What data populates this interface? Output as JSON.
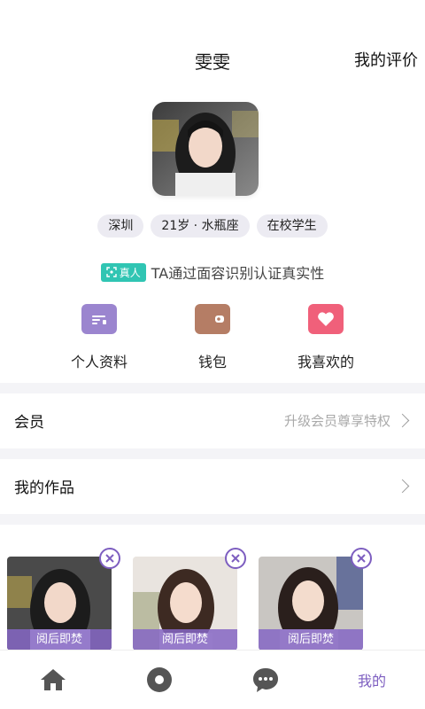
{
  "header": {
    "title": "雯雯",
    "right_link": "我的评价"
  },
  "profile": {
    "tags": [
      "深圳",
      "21岁 · 水瓶座",
      "在校学生"
    ],
    "verify_badge": "真人",
    "verify_text": "TA通过面容识别认证真实性"
  },
  "actions": [
    {
      "label": "个人资料",
      "icon": "id-card-icon"
    },
    {
      "label": "钱包",
      "icon": "wallet-icon"
    },
    {
      "label": "我喜欢的",
      "icon": "heart-icon"
    }
  ],
  "rows": {
    "member": {
      "title": "会员",
      "hint": "升级会员尊享特权"
    },
    "works": {
      "title": "我的作品"
    }
  },
  "gallery": {
    "items": [
      {
        "caption": "阅后即焚"
      },
      {
        "caption": "阅后即焚"
      },
      {
        "caption": "阅后即焚"
      }
    ]
  },
  "bottom_nav": {
    "items": [
      {
        "icon": "home-icon"
      },
      {
        "icon": "circle-icon"
      },
      {
        "icon": "chat-icon"
      },
      {
        "label": "我的"
      }
    ]
  },
  "colors": {
    "accent": "#7d5ec0",
    "verify": "#30c5b3",
    "wallet": "#b57d65",
    "heart": "#f0607a",
    "profile": "#9b85cf"
  }
}
